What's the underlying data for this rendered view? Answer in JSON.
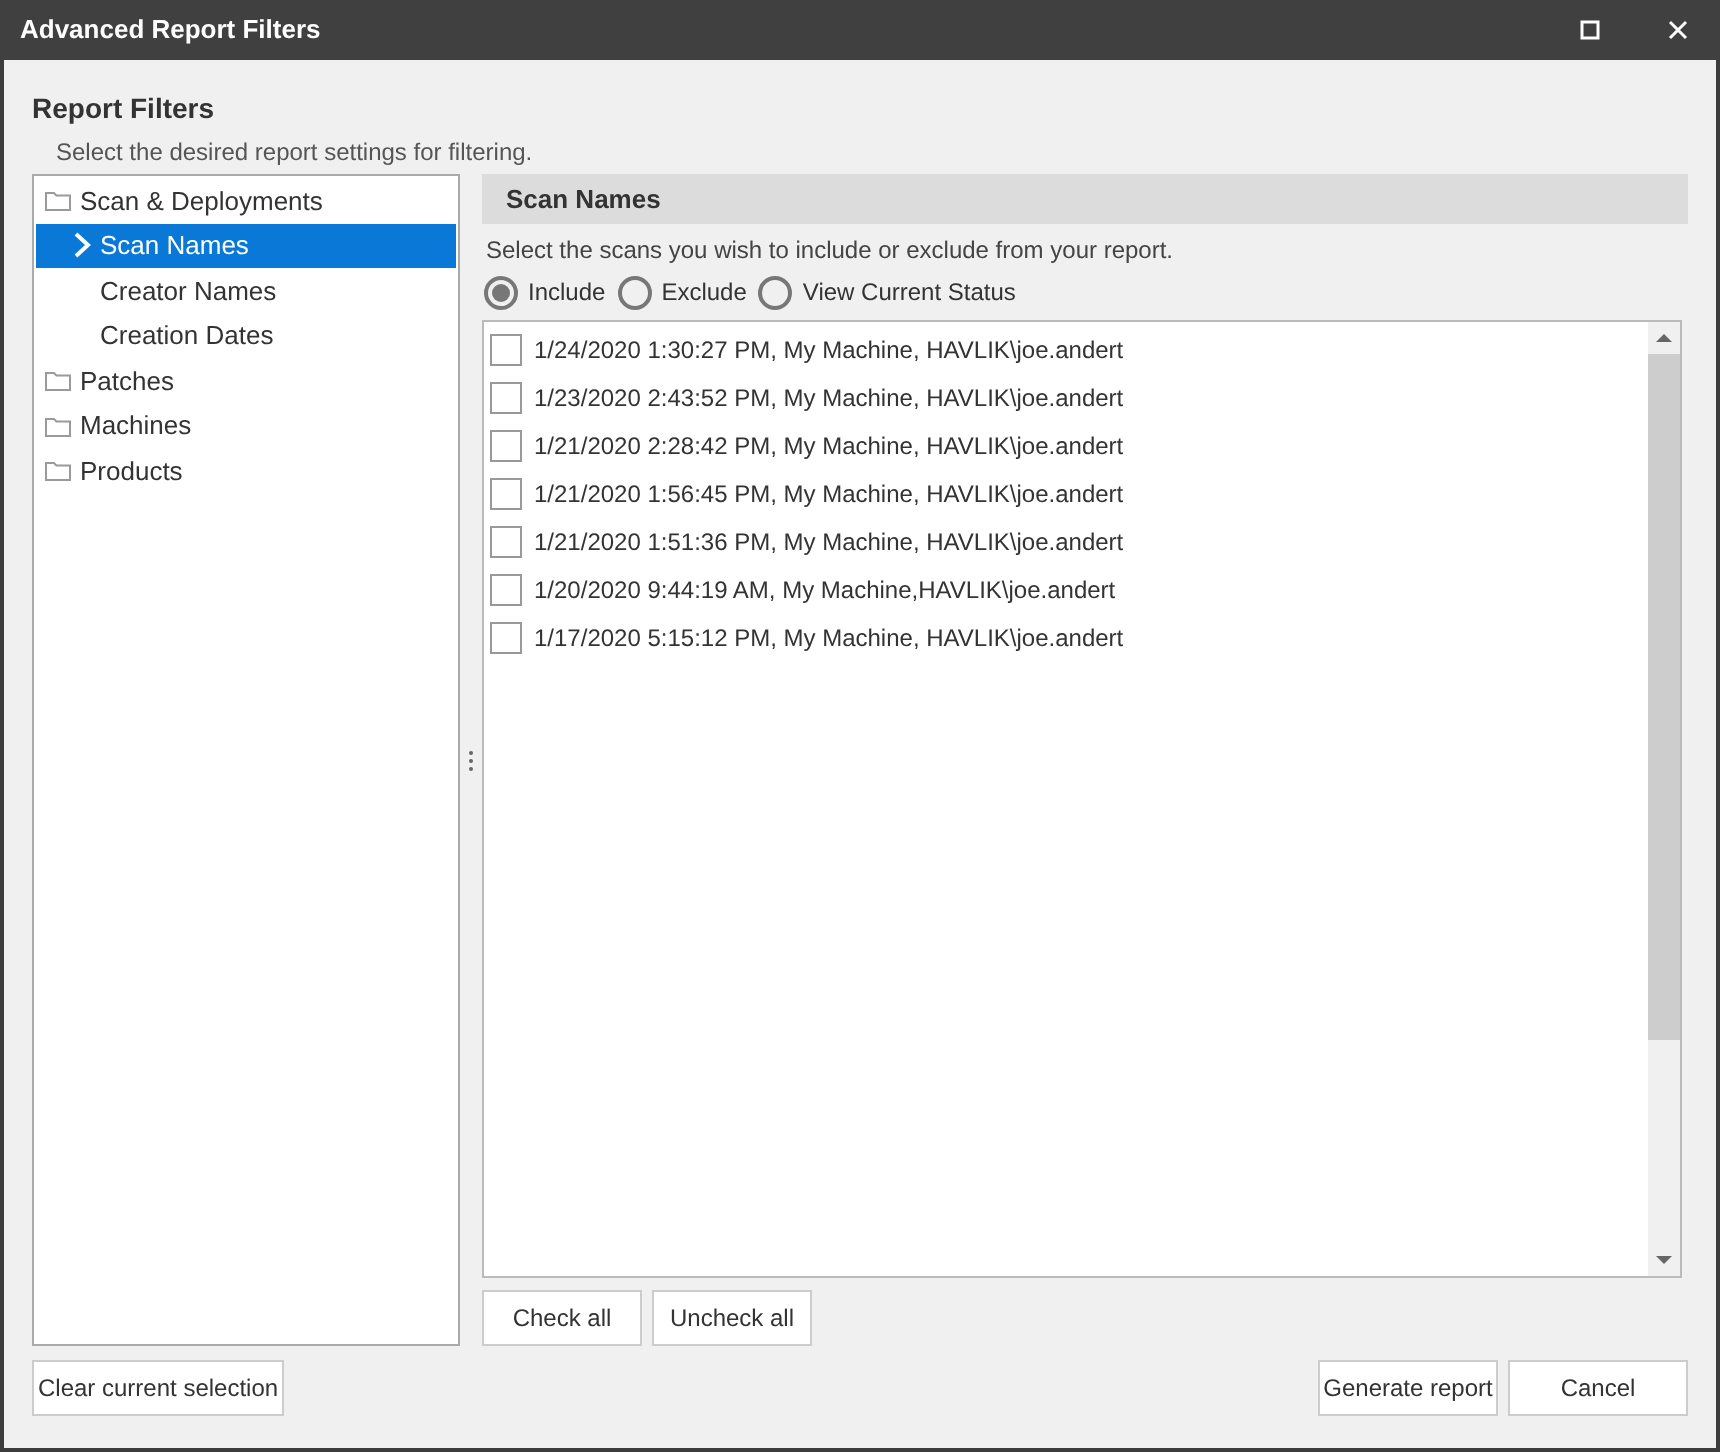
{
  "window": {
    "title": "Advanced Report Filters"
  },
  "heading": "Report Filters",
  "subtitle": "Select the desired report settings for filtering.",
  "tree": [
    {
      "label": "Scan & Deployments",
      "selected": false,
      "children": [
        {
          "label": "Scan Names",
          "selected": true
        },
        {
          "label": "Creator Names",
          "selected": false
        },
        {
          "label": "Creation Dates",
          "selected": false
        }
      ]
    },
    {
      "label": "Patches",
      "selected": false
    },
    {
      "label": "Machines",
      "selected": false
    },
    {
      "label": "Products",
      "selected": false
    }
  ],
  "panel": {
    "title": "Scan Names",
    "description": "Select the scans you wish to include or exclude from your report.",
    "options": [
      {
        "label": "Include",
        "selected": true
      },
      {
        "label": "Exclude",
        "selected": false
      },
      {
        "label": "View Current Status",
        "selected": false
      }
    ],
    "scans": [
      {
        "label": "1/24/2020 1:30:27 PM, My Machine, HAVLIK\\joe.andert",
        "checked": false
      },
      {
        "label": "1/23/2020 2:43:52 PM, My Machine, HAVLIK\\joe.andert",
        "checked": false
      },
      {
        "label": "1/21/2020 2:28:42 PM, My Machine, HAVLIK\\joe.andert",
        "checked": false
      },
      {
        "label": "1/21/2020 1:56:45 PM, My Machine, HAVLIK\\joe.andert",
        "checked": false
      },
      {
        "label": "1/21/2020 1:51:36 PM, My Machine, HAVLIK\\joe.andert",
        "checked": false
      },
      {
        "label": "1/20/2020 9:44:19 AM, My Machine,HAVLIK\\joe.andert",
        "checked": false
      },
      {
        "label": "1/17/2020 5:15:12 PM, My Machine, HAVLIK\\joe.andert",
        "checked": false
      }
    ],
    "list_buttons": [
      "Check all",
      "Uncheck all"
    ]
  },
  "footer": {
    "left_button": "Clear current selection",
    "buttons": [
      "Generate report",
      "Cancel"
    ]
  }
}
